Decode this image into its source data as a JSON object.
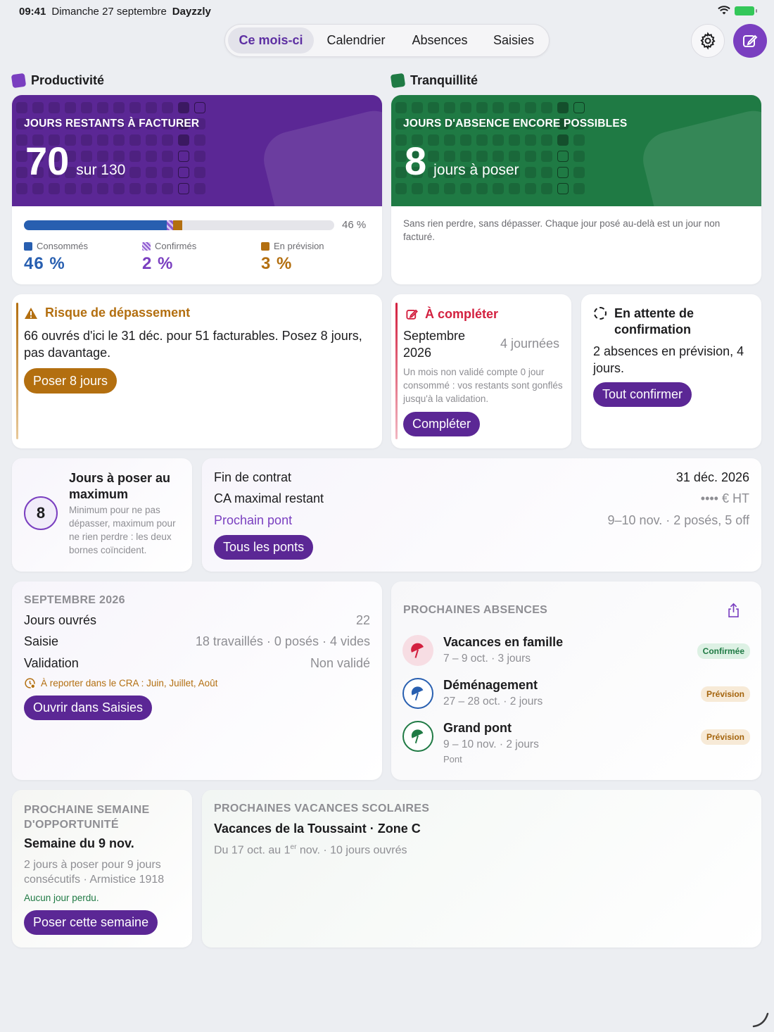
{
  "status_bar": {
    "time": "09:41",
    "date": "Dimanche 27 septembre",
    "app": "Dayzzly"
  },
  "tabs": [
    {
      "label": "Ce mois-ci",
      "active": true
    },
    {
      "label": "Calendrier",
      "active": false
    },
    {
      "label": "Absences",
      "active": false
    },
    {
      "label": "Saisies",
      "active": false
    }
  ],
  "productivity": {
    "section_title": "Productivité",
    "hero_label": "JOURS RESTANTS À FACTURER",
    "value": "70",
    "of_total": "sur 130",
    "progress_percent_label": "46 %",
    "bar": {
      "consumed_pct": 46,
      "confirmed_pct": 2,
      "forecast_pct": 3
    },
    "legend": [
      {
        "label": "Consommés",
        "value": "46 %",
        "color": "#285fb0"
      },
      {
        "label": "Confirmés",
        "value": "2 %",
        "color": "#7a3fc0"
      },
      {
        "label": "En prévision",
        "value": "3 %",
        "color": "#b36f10"
      }
    ]
  },
  "tranquility": {
    "section_title": "Tranquillité",
    "hero_label": "JOURS D'ABSENCE ENCORE POSSIBLES",
    "value": "8",
    "unit": "jours à poser",
    "description": "Sans rien perdre, sans dépasser. Chaque jour posé au-delà est un jour non facturé."
  },
  "risk": {
    "title": "Risque de dépassement",
    "text": "66 ouvrés d'ici le 31 déc. pour 51 facturables. Posez 8 jours, pas davantage.",
    "button": "Poser 8 jours"
  },
  "to_complete": {
    "title": "À compléter",
    "month": "Septembre 2026",
    "count": "4 journées",
    "note": "Un mois non validé compte 0 jour consommé : vos restants sont gonflés jusqu'à la validation.",
    "button": "Compléter"
  },
  "pending": {
    "title": "En attente de confirmation",
    "text": "2 absences en prévision, 4 jours.",
    "button": "Tout confirmer"
  },
  "max_days": {
    "value": "8",
    "title": "Jours à poser au maximum",
    "text": "Minimum pour ne pas dépasser, maximum pour ne rien perdre : les deux bornes coïncident."
  },
  "contract": {
    "rows": [
      {
        "label": "Fin de contrat",
        "value": "31 déc. 2026"
      },
      {
        "label": "CA maximal restant",
        "value": "•••• € HT"
      },
      {
        "label": "Prochain pont",
        "value": "9–10 nov. · 2 posés, 5 off"
      }
    ],
    "button": "Tous les ponts"
  },
  "month": {
    "title": "SEPTEMBRE 2026",
    "rows": [
      {
        "label": "Jours ouvrés",
        "value": "22"
      },
      {
        "label": "Saisie",
        "value": "18 travaillés · 0 posés · 4 vides"
      },
      {
        "label": "Validation",
        "value": "Non validé"
      }
    ],
    "warning": "À reporter dans le CRA : Juin, Juillet, Août",
    "button": "Ouvrir dans Saisies"
  },
  "upcoming": {
    "title": "PROCHAINES ABSENCES",
    "items": [
      {
        "name": "Vacances en famille",
        "dates": "7 – 9 oct. · 3 jours",
        "extra": "",
        "status": "Confirmée",
        "color": "#d3203f"
      },
      {
        "name": "Déménagement",
        "dates": "27 – 28 oct. · 2 jours",
        "extra": "",
        "status": "Prévision",
        "color": "#285fb0"
      },
      {
        "name": "Grand pont",
        "dates": "9 – 10 nov. · 2 jours",
        "extra": "Pont",
        "status": "Prévision",
        "color": "#1f7a44"
      }
    ]
  },
  "opportunity": {
    "title": "PROCHAINE SEMAINE D'OPPORTUNITÉ",
    "week": "Semaine du 9 nov.",
    "text": "2 jours à poser pour 9 jours consécutifs · Armistice 1918",
    "note": "Aucun jour perdu.",
    "button": "Poser cette semaine"
  },
  "school": {
    "title": "PROCHAINES VACANCES SCOLAIRES",
    "name": "Vacances de la Toussaint · Zone C",
    "dates_prefix": "Du 17 oct. au 1",
    "dates_sup": "er",
    "dates_suffix": " nov. · 10 jours ouvrés"
  }
}
